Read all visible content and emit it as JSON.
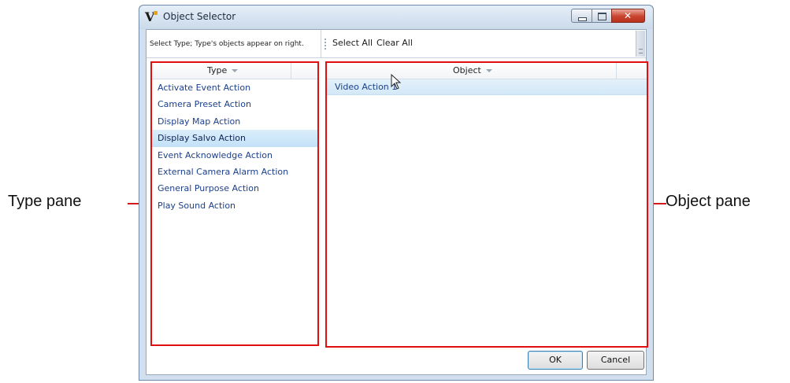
{
  "window": {
    "title": "Object Selector",
    "app_icon": "v-logo-icon"
  },
  "hint": "Select Type; Type's objects appear on right.",
  "toolbar": {
    "select_all": "Select All",
    "clear_all": "Clear All"
  },
  "type_pane": {
    "column_header": "Type",
    "items": [
      "Activate Event Action",
      "Camera Preset Action",
      "Display Map Action",
      "Display Salvo Action",
      "Event Acknowledge Action",
      "External Camera Alarm Action",
      "General Purpose Action",
      "Play Sound Action"
    ],
    "selected": "Display Salvo Action"
  },
  "object_pane": {
    "column_header": "Object",
    "rows": [
      "Video Action 1"
    ]
  },
  "buttons": {
    "ok": "OK",
    "cancel": "Cancel"
  },
  "annotations": {
    "left": "Type pane",
    "right": "Object pane"
  },
  "colors": {
    "highlight_border": "#e01010",
    "link_text": "#1c3f8c",
    "selection": "#c2e1f7"
  }
}
